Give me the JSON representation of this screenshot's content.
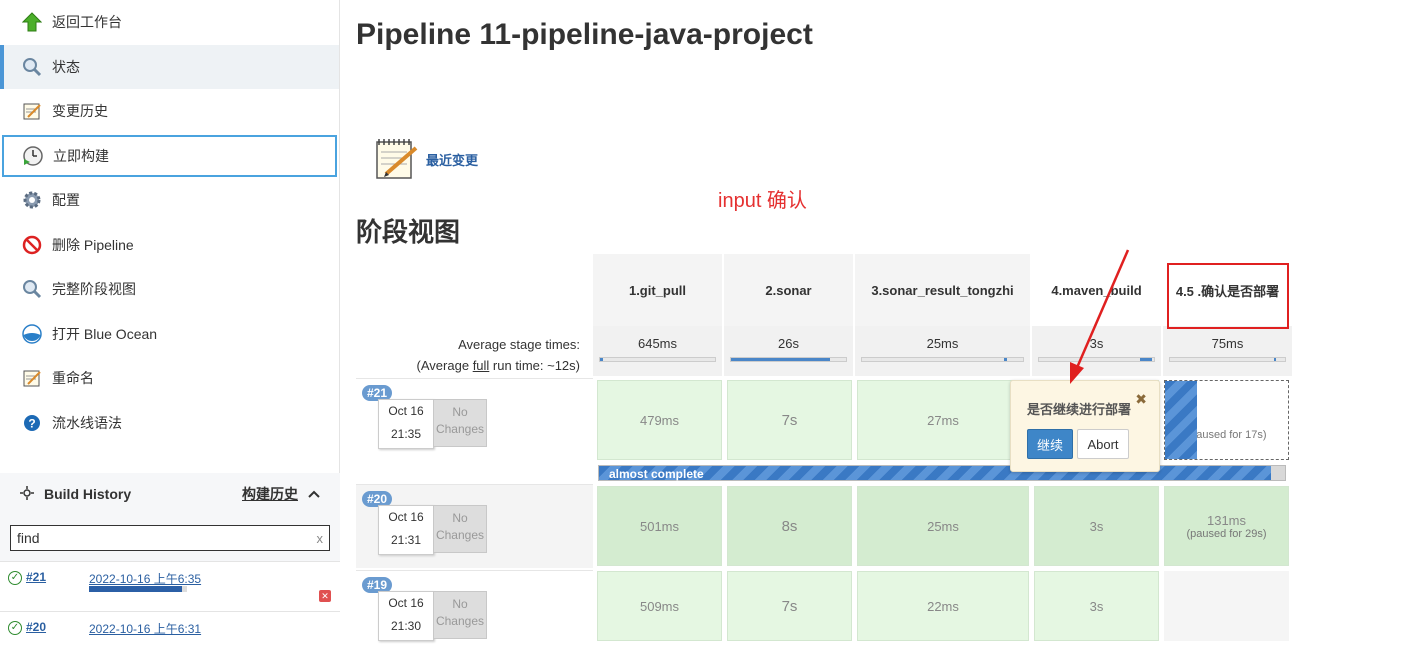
{
  "sidebar": {
    "items": [
      {
        "label": "返回工作台",
        "icon": "arrow-up-icon"
      },
      {
        "label": "状态",
        "icon": "magnifier-icon"
      },
      {
        "label": "变更历史",
        "icon": "notepad-icon"
      },
      {
        "label": "立即构建",
        "icon": "clock-build-icon"
      },
      {
        "label": "配置",
        "icon": "gear-icon"
      },
      {
        "label": "删除 Pipeline",
        "icon": "no-entry-icon"
      },
      {
        "label": "完整阶段视图",
        "icon": "magnifier-icon"
      },
      {
        "label": "打开 Blue Ocean",
        "icon": "blue-ocean-icon"
      },
      {
        "label": "重命名",
        "icon": "notepad-icon"
      },
      {
        "label": "流水线语法",
        "icon": "help-icon"
      }
    ]
  },
  "build_history": {
    "title": "Build History",
    "trend_link": "构建历史",
    "search_value": "find",
    "clear": "x",
    "builds": [
      {
        "number": "#21",
        "date": "2022-10-16 上午6:35",
        "progress": 0.95
      },
      {
        "number": "#20",
        "date": "2022-10-16 上午6:31"
      }
    ]
  },
  "main": {
    "title": "Pipeline 11-pipeline-java-project",
    "recent_changes": "最近变更",
    "annotation": "input  确认",
    "stage_view_title": "阶段视图"
  },
  "stage_view": {
    "stages": [
      "1.git_pull",
      "2.sonar",
      "3.sonar_result_tongzhi",
      "4.maven_build",
      "4.5 .确认是否部署"
    ],
    "avg_times": [
      "645ms",
      "26s",
      "25ms",
      "3s",
      "75ms"
    ],
    "avg_bars": [
      0.05,
      0.9,
      0.05,
      0.1,
      0.05
    ],
    "avg_label_1": "Average stage times:",
    "avg_label_2_pre": "(Average ",
    "avg_label_2_link": "full",
    "avg_label_2_post": " run time: ~12s)",
    "runs": [
      {
        "badge": "#21",
        "date": "Oct 16",
        "time": "21:35",
        "changes": "No Changes",
        "cells": [
          "479ms",
          "7s",
          "27ms",
          "",
          ""
        ],
        "paused": "(paused for 17s)"
      },
      {
        "badge": "#20",
        "date": "Oct 16",
        "time": "21:31",
        "changes": "No Changes",
        "cells": [
          "501ms",
          "8s",
          "25ms",
          "3s",
          "131ms"
        ],
        "paused": "(paused for 29s)"
      },
      {
        "badge": "#19",
        "date": "Oct 16",
        "time": "21:30",
        "changes": "No Changes",
        "cells": [
          "509ms",
          "7s",
          "22ms",
          "3s",
          ""
        ]
      }
    ],
    "progress_text": "almost complete",
    "popup": {
      "question": "是否继续进行部署",
      "proceed": "继续",
      "abort": "Abort",
      "close": "✖"
    }
  },
  "colors": {
    "accent": "#3e86c8",
    "success": "#e5f7e2",
    "annotation": "#e02020"
  }
}
